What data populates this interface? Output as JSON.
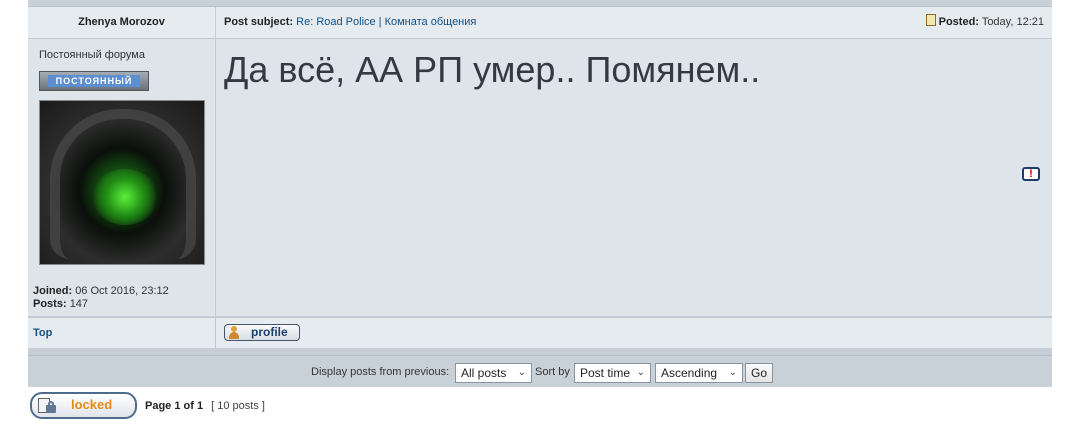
{
  "post": {
    "author": "Zhenya Morozov",
    "subject_label": "Post subject:",
    "subject_link": "Re: Road Police | Комната общения",
    "posted_label": "Posted:",
    "posted_time": "Today, 12:21",
    "message": "Да всё, АА РП умер.. Помянем.."
  },
  "user": {
    "rank_title": "Постоянный форума",
    "rank_badge_text": "ПОСТОЯННЫЙ",
    "joined_label": "Joined:",
    "joined_value": "06 Oct 2016, 23:12",
    "posts_label": "Posts:",
    "posts_value": "147"
  },
  "footer": {
    "top_link": "Top",
    "profile_label": "profile"
  },
  "sort_bar": {
    "display_label": "Display posts from previous:",
    "display_selected": "All posts",
    "sort_by_label": "Sort by",
    "sort_selected": "Post time",
    "order_selected": "Ascending",
    "go_label": "Go"
  },
  "bottom": {
    "locked_label": "locked",
    "page_info": "Page 1 of 1",
    "post_count": "[ 10 posts ]"
  },
  "colors": {
    "link": "#105289",
    "locked_text": "#e78a1a",
    "post_bg": "#dde4ea",
    "header_bg": "#e6ebef"
  }
}
